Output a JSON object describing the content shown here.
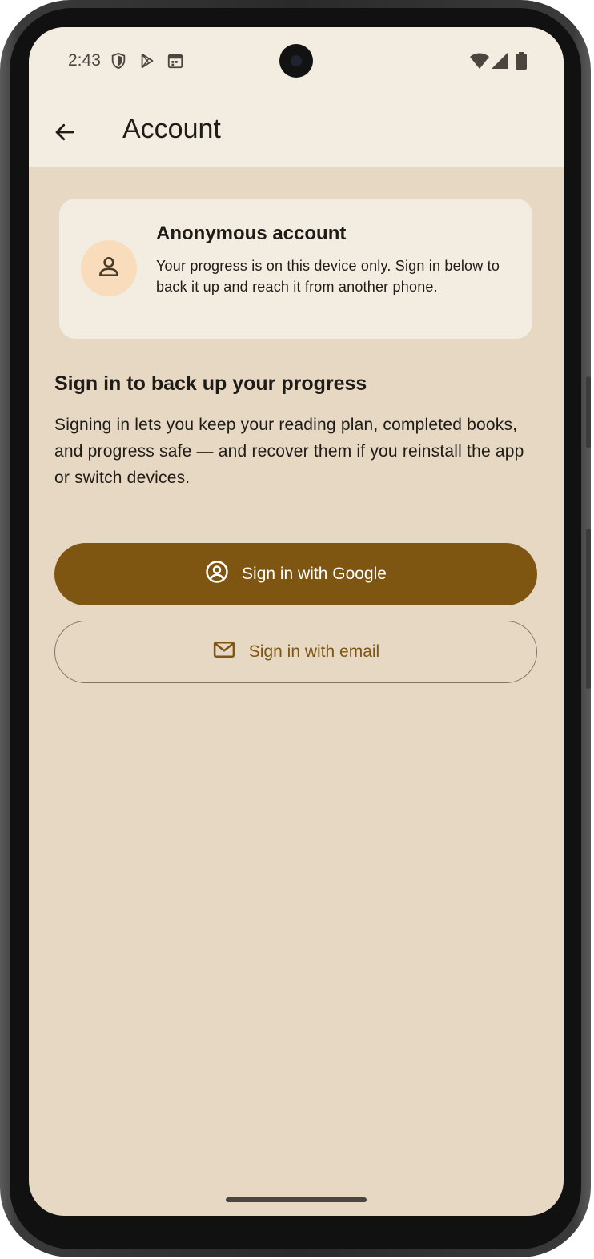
{
  "status_bar": {
    "time": "2:43",
    "left_icons": [
      "shield-icon",
      "play-store-icon",
      "calendar-icon"
    ],
    "right_icons": [
      "wifi-icon",
      "cell-signal-icon",
      "battery-icon"
    ]
  },
  "app_bar": {
    "back_icon": "arrow-back-icon",
    "title": "Account"
  },
  "account_card": {
    "avatar_icon": "person-icon",
    "title": "Anonymous account",
    "description": "Your progress is on this device only. Sign in below to back it up and reach it from another phone."
  },
  "sign_in_section": {
    "title": "Sign in to back up your progress",
    "description": "Signing in lets you keep your reading plan, completed books, and progress safe — and recover them if you reinstall the app or switch devices."
  },
  "buttons": {
    "google": {
      "label": "Sign in with Google",
      "icon": "account-circle-icon"
    },
    "email": {
      "label": "Sign in with email",
      "icon": "mail-icon"
    }
  },
  "colors": {
    "primary": "#7f5611",
    "surface": "#f3ece1",
    "background": "#e6d8c3",
    "avatar_bg": "#f8dcbb",
    "text": "#1f1b16"
  }
}
